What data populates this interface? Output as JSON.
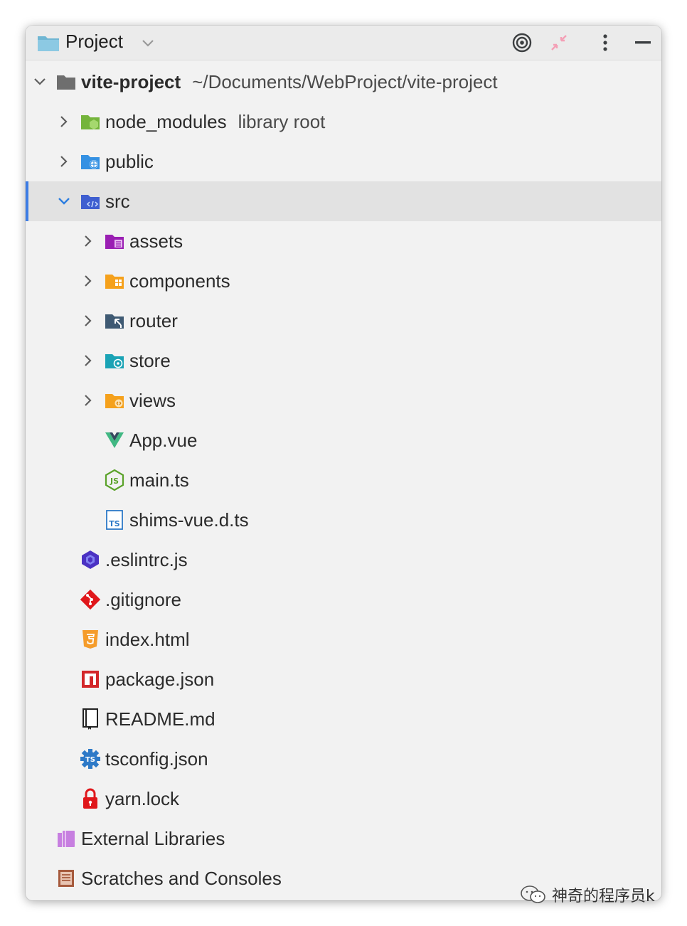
{
  "toolbar": {
    "title": "Project",
    "icons": [
      "folder-icon",
      "chevron-down-icon",
      "locate-target-icon",
      "collapse-all-icon",
      "more-options-icon",
      "minimize-icon"
    ]
  },
  "tree": {
    "root": {
      "name": "vite-project",
      "path": "~/Documents/WebProject/vite-project"
    },
    "node_modules": {
      "name": "node_modules",
      "hint": "library root"
    },
    "public": {
      "name": "public"
    },
    "src": {
      "name": "src"
    },
    "assets": {
      "name": "assets"
    },
    "components": {
      "name": "components"
    },
    "router": {
      "name": "router"
    },
    "store": {
      "name": "store"
    },
    "views": {
      "name": "views"
    },
    "app_vue": {
      "name": "App.vue"
    },
    "main_ts": {
      "name": "main.ts"
    },
    "shims": {
      "name": "shims-vue.d.ts"
    },
    "eslintrc": {
      "name": ".eslintrc.js"
    },
    "gitignore": {
      "name": ".gitignore"
    },
    "index_html": {
      "name": "index.html"
    },
    "package_json": {
      "name": "package.json"
    },
    "readme": {
      "name": "README.md"
    },
    "tsconfig": {
      "name": "tsconfig.json"
    },
    "yarn_lock": {
      "name": "yarn.lock"
    },
    "external_libraries": {
      "name": "External Libraries"
    },
    "scratches": {
      "name": "Scratches and Consoles"
    }
  },
  "watermark": {
    "text": "神奇的程序员k"
  },
  "colors": {
    "selection_bar": "#3d7de5",
    "selected_row": "#e2e2e2",
    "panel_bg": "#f2f2f2",
    "toolbar_bg": "#ebebeb"
  }
}
